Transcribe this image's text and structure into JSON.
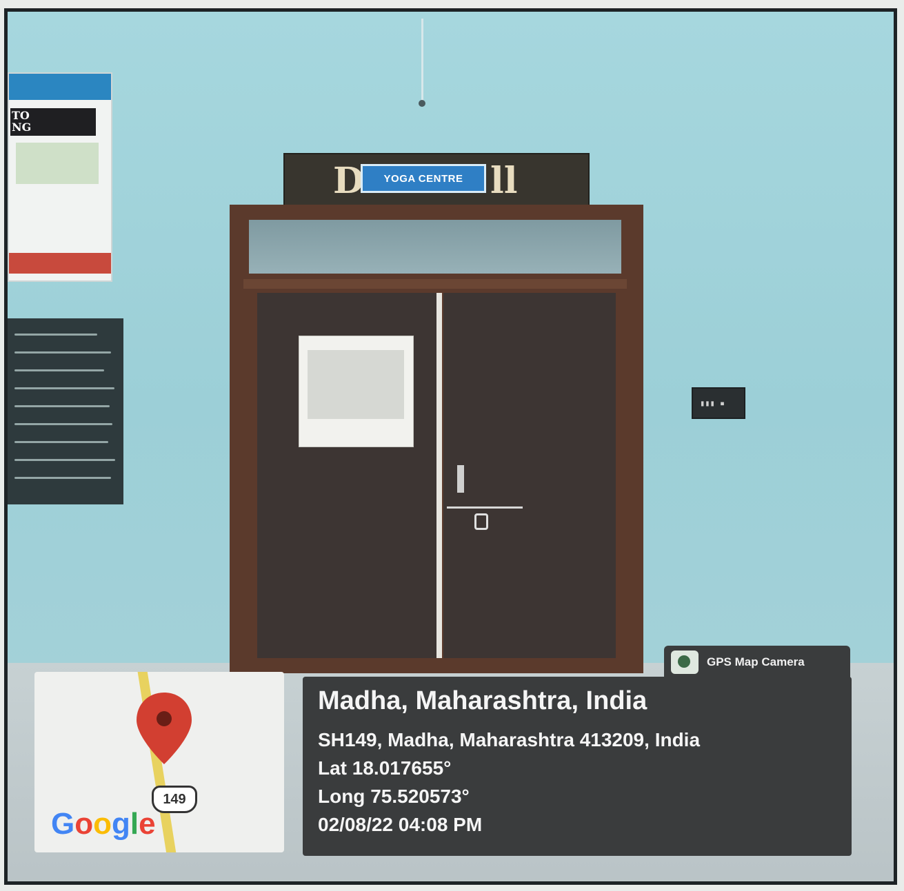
{
  "scene": {
    "yoga_label": "YOGA CENTRE",
    "sign_left_letter": "D",
    "sign_right_letters": "ll",
    "poster_text_line1": "TO",
    "poster_text_line2": "NG"
  },
  "map": {
    "route_number": "149",
    "logo_text": "Google",
    "logo_colors": [
      "#4285F4",
      "#EA4335",
      "#FBBC05",
      "#4285F4",
      "#34A853",
      "#EA4335"
    ],
    "pin_color": "#d23f31"
  },
  "overlay": {
    "app_name": "GPS Map Camera",
    "title": "Madha, Maharashtra, India",
    "address": "SH149, Madha, Maharashtra 413209, India",
    "lat": "Lat 18.017655°",
    "long": "Long 75.520573°",
    "datetime": "02/08/22 04:08 PM"
  }
}
